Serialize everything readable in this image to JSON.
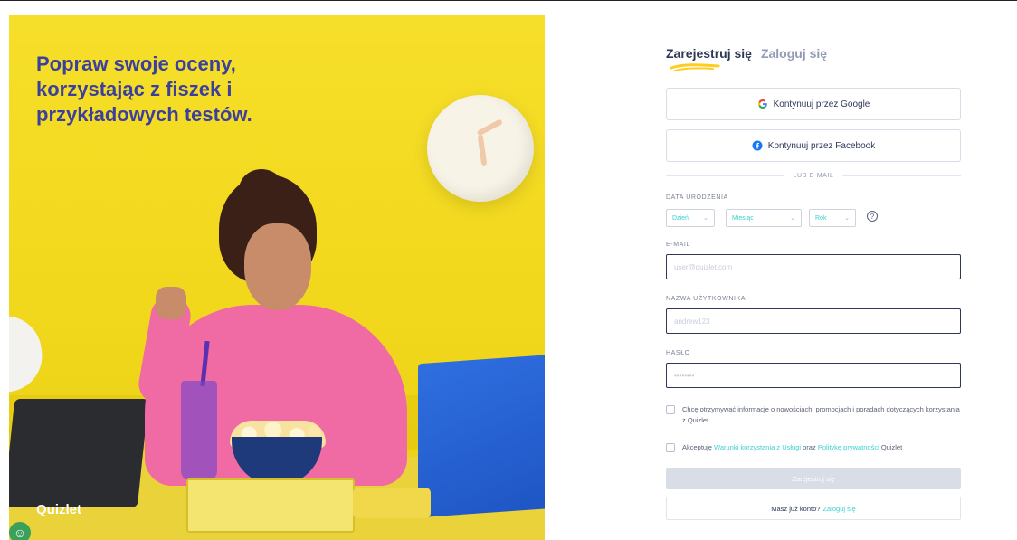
{
  "hero": {
    "headline": "Popraw swoje oceny,\nkorzystając z fiszek i\nprzykładowych testów.",
    "brand": "Quizlet",
    "colors": {
      "background": "#f2d81c",
      "headline": "#3b3f9e"
    },
    "help_icon": "accessibility-icon"
  },
  "tabs": [
    {
      "label": "Zarejestruj się",
      "active": true
    },
    {
      "label": "Zaloguj się",
      "active": false
    }
  ],
  "social": {
    "google_label": "Kontynuuj przez Google",
    "facebook_label": "Kontynuuj przez Facebook",
    "google_icon": "google-icon",
    "facebook_icon": "facebook-icon"
  },
  "divider": "LUB E-MAIL",
  "birthdate": {
    "label": "DATA URODZENIA",
    "day": "Dzień",
    "month": "Miesiąc",
    "year": "Rok",
    "help_icon": "question-circle-icon"
  },
  "email": {
    "label": "E-MAIL",
    "placeholder": "user@quizlet.com"
  },
  "username": {
    "label": "NAZWA UŻYTKOWNIKA",
    "placeholder": "andrew123"
  },
  "password": {
    "label": "HASŁO",
    "placeholder": "••••••••"
  },
  "consent": {
    "marketing": "Chcę otrzymywać informacje o nowościach, promocjach i poradach dotyczących korzystania z Quizlet",
    "terms_prefix": "Akceptuję ",
    "terms_link": "Warunki korzystania z Usługi",
    "terms_mid": " oraz ",
    "privacy_link": "Politykę prywatności",
    "terms_suffix": " Quizlet"
  },
  "submit_label": "Zarejestruj się",
  "login_prompt": {
    "text": "Masz już konto?",
    "link": "Zaloguj się"
  },
  "colors": {
    "text_dark": "#2e3856",
    "text_muted": "#939bb4",
    "accent_teal": "#3ccfcf",
    "underline_yellow": "#ffcd1f",
    "button_disabled": "#d9dde6"
  }
}
